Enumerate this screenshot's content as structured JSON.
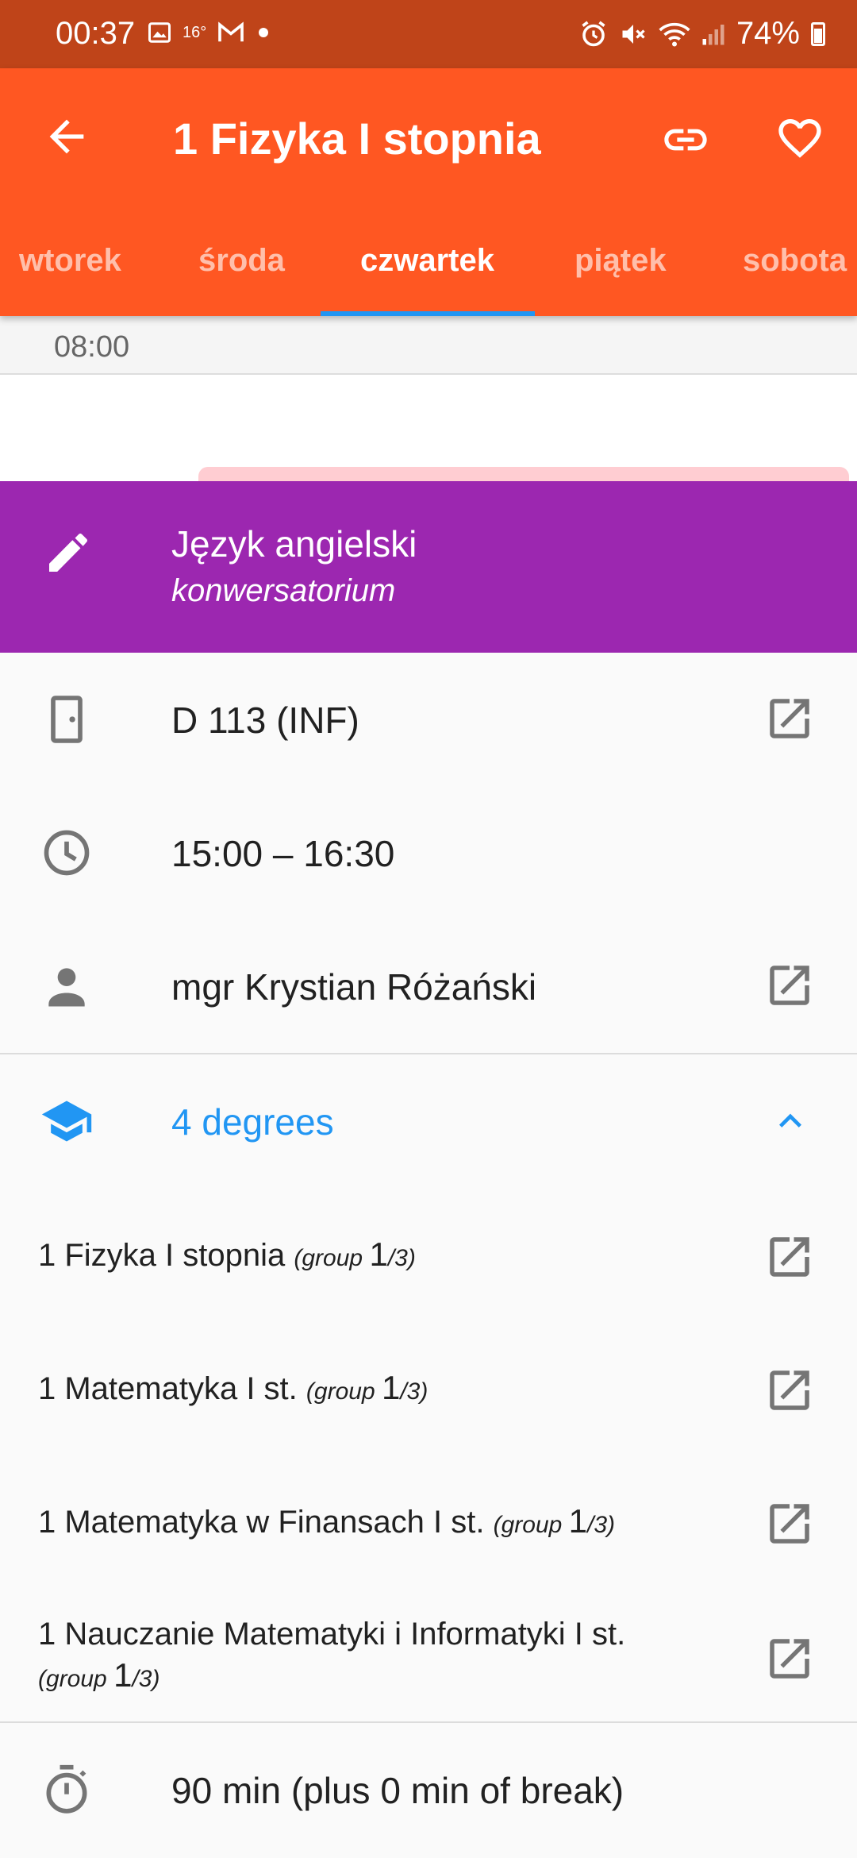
{
  "status_bar": {
    "time": "00:37",
    "temp": "16°",
    "battery": "74%"
  },
  "app_bar": {
    "title": "1 Fizyka I stopnia",
    "icons": [
      "back-arrow-icon",
      "link-icon",
      "heart-icon"
    ]
  },
  "tabs": [
    {
      "label": "wtorek",
      "active": false
    },
    {
      "label": "środa",
      "active": false
    },
    {
      "label": "czwartek",
      "active": true
    },
    {
      "label": "piątek",
      "active": false
    },
    {
      "label": "sobota",
      "active": false
    }
  ],
  "timeline": {
    "time": "08:00"
  },
  "course": {
    "name": "Język angielski",
    "type": "konwersatorium",
    "color": "#9c27b0"
  },
  "details": {
    "room": "D 113 (INF)",
    "time": "15:00 – 16:30",
    "teacher": "mgr Krystian Różański",
    "degrees_label": "4 degrees",
    "duration": "90 min (plus 0 min of break)"
  },
  "degrees": [
    {
      "name": "1 Fizyka I stopnia",
      "group_word": "group",
      "group_num": "1",
      "group_total": "/3"
    },
    {
      "name": "1 Matematyka I st.",
      "group_word": "group",
      "group_num": "1",
      "group_total": "/3"
    },
    {
      "name": "1 Matematyka w Finansach I st.",
      "group_word": "group",
      "group_num": "1",
      "group_total": "/3"
    },
    {
      "name": "1 Nauczanie Matematyki i Informatyki I st.",
      "group_word": "group",
      "group_num": "1",
      "group_total": "/3"
    }
  ],
  "colors": {
    "status_bar": "#bf4419",
    "app_bar": "#ff5722",
    "accent": "#2196f3"
  }
}
